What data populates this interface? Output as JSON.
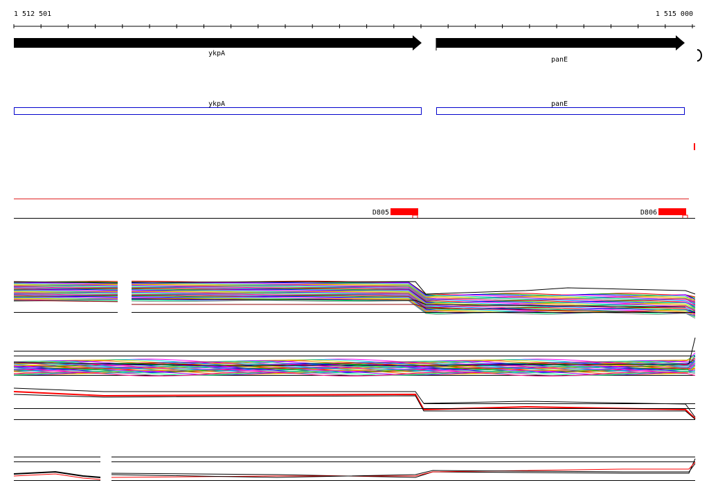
{
  "ruler": {
    "start_label": "1 512 501",
    "end_label": "1 515 000"
  },
  "genes": [
    {
      "name": "ykpA"
    },
    {
      "name": "panE"
    }
  ],
  "annotations": [
    {
      "name": "ykpA"
    },
    {
      "name": "panE"
    }
  ],
  "features": [
    {
      "label": "D805"
    },
    {
      "label": "D806"
    }
  ],
  "colors": {
    "background": "#ffffff",
    "axis": "#000000",
    "gene_arrow": "#000000",
    "annotation_box": "#0000cc",
    "feature": "#ff0000",
    "threshold_line": "#e02020",
    "trace_palette": [
      "#ff0000",
      "#00aa00",
      "#0000ff",
      "#ff00ff",
      "#00cccc",
      "#cccc00",
      "#ff8800",
      "#8800ff",
      "#00ff88",
      "#888888",
      "#ff0088",
      "#0088ff"
    ]
  }
}
